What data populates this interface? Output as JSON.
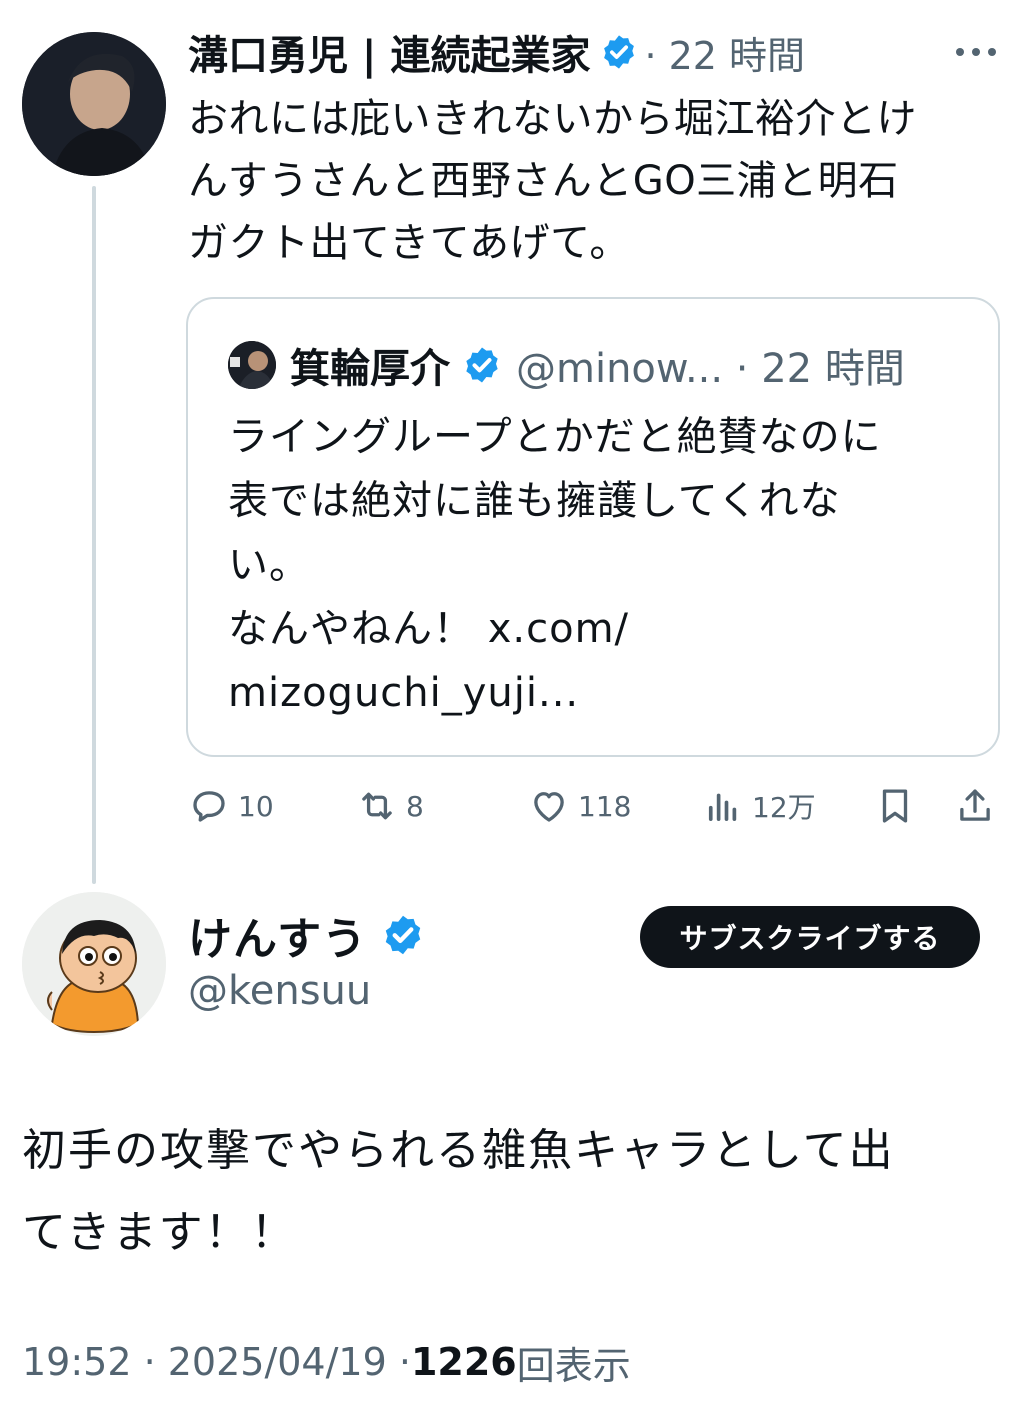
{
  "parent_tweet": {
    "display_name": "溝口勇児 | 連続起業家",
    "time_meta": "· 22 時間",
    "text_lines": [
      "おれには庇いきれないから堀江裕介とけ",
      "んすうさんと西野さんとGO三浦と明石",
      "ガクト出てきてあげて。"
    ],
    "quote": {
      "display_name": "箕輪厚介",
      "handle_meta": "@minow... · 22 時間",
      "text_lines": [
        "ライングループとかだと絶賛なのに",
        "表では絶対に誰も擁護してくれな",
        "い。",
        "なんやねん！ x.com/",
        "mizoguchi_yuji..."
      ]
    },
    "actions": {
      "replies": "10",
      "reposts": "8",
      "likes": "118",
      "views": "12万"
    }
  },
  "main_tweet": {
    "display_name": "けんすう",
    "handle": "@kensuu",
    "subscribe_label": "サブスクライブする",
    "text_lines": [
      "初手の攻撃でやられる雑魚キャラとして出",
      "てきます！！"
    ],
    "footer": {
      "time_date": "19:52 · 2025/04/19 · ",
      "view_count": "1226",
      "view_label": " 回表示"
    }
  },
  "colors": {
    "verified_blue": "#1d9bf0",
    "text_primary": "#0f1419",
    "text_secondary": "#536471",
    "border": "#cfd9de"
  },
  "icons": [
    "more-icon",
    "verified-icon",
    "reply-icon",
    "repost-icon",
    "like-icon",
    "views-icon",
    "bookmark-icon",
    "share-icon"
  ]
}
